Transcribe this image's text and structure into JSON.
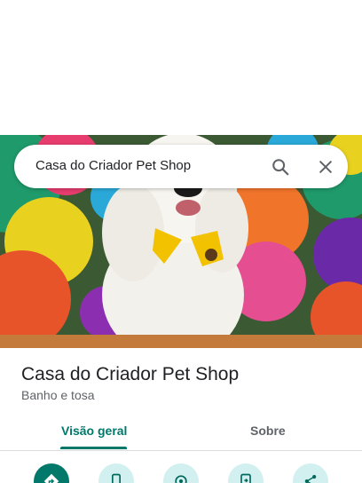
{
  "search": {
    "query": "Casa do Criador Pet Shop",
    "search_icon": "search-icon",
    "close_icon": "close-icon"
  },
  "place": {
    "name": "Casa do Criador Pet Shop",
    "category": "Banho e tosa"
  },
  "tabs": [
    {
      "label": "Visão geral",
      "active": true
    },
    {
      "label": "Sobre",
      "active": false
    }
  ],
  "actions": [
    {
      "icon": "directions-icon",
      "primary": true
    },
    {
      "icon": "phone-icon",
      "primary": false
    },
    {
      "icon": "location-icon",
      "primary": false
    },
    {
      "icon": "send-to-phone-icon",
      "primary": false
    },
    {
      "icon": "share-icon",
      "primary": false
    }
  ],
  "colors": {
    "accent": "#00796b",
    "action_secondary_bg": "#d2f0f0",
    "title": "#202124",
    "subtitle": "#5f6368"
  }
}
